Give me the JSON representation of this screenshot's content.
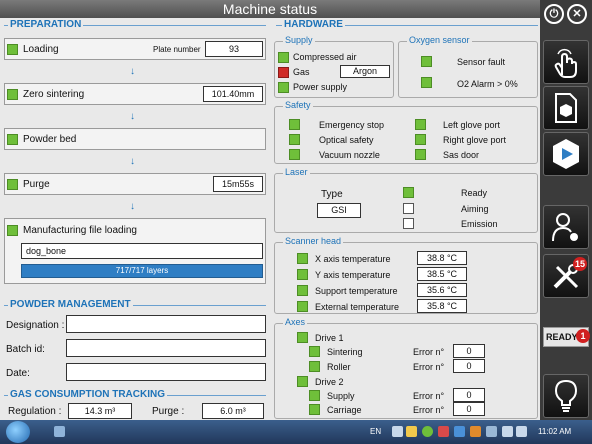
{
  "window": {
    "title": "Machine status"
  },
  "preparation": {
    "title": "PREPARATION",
    "loading": {
      "label": "Loading",
      "plate_label": "Plate number",
      "plate_value": "93"
    },
    "zero_sintering": {
      "label": "Zero sintering",
      "value": "101.40mm"
    },
    "powder_bed": {
      "label": "Powder bed"
    },
    "purge": {
      "label": "Purge",
      "value": "15m55s"
    },
    "manufacturing": {
      "label": "Manufacturing file loading",
      "file": "dog_bone",
      "progress_text": "717/717 layers",
      "progress_fraction": 1.0
    },
    "arrow": "↓"
  },
  "powder": {
    "title": "POWDER MANAGEMENT",
    "designation_label": "Designation :",
    "batch_label": "Batch id:",
    "date_label": "Date:",
    "designation_value": "",
    "batch_value": "",
    "date_value": ""
  },
  "gas": {
    "title": "GAS CONSUMPTION TRACKING",
    "regulation_label": "Regulation :",
    "regulation_value": "14.3 m³",
    "purge_label": "Purge :",
    "purge_value": "6.0 m³"
  },
  "hardware": {
    "title": "HARDWARE",
    "supply": {
      "title": "Supply",
      "compressed_air": "Compressed air",
      "gas": "Gas",
      "gas_value": "Argon",
      "power_supply": "Power supply"
    },
    "oxygen": {
      "title": "Oxygen sensor",
      "sensor_fault": "Sensor fault",
      "alarm": "O2 Alarm > 0%"
    },
    "safety": {
      "title": "Safety",
      "emergency_stop": "Emergency stop",
      "optical_safety": "Optical safety",
      "vacuum_nozzle": "Vacuum nozzle",
      "left_glove": "Left glove port",
      "right_glove": "Right glove port",
      "sas_door": "Sas door"
    },
    "laser": {
      "title": "Laser",
      "type_label": "Type",
      "type_value": "GSI",
      "ready": "Ready",
      "aiming": "Aiming",
      "emission": "Emission"
    },
    "scanner": {
      "title": "Scanner head",
      "x_label": "X axis temperature",
      "x_value": "38.8 °C",
      "y_label": "Y axis temperature",
      "y_value": "38.5 °C",
      "support_label": "Support temperature",
      "support_value": "35.6 °C",
      "external_label": "External temperature",
      "external_value": "35.8 °C"
    },
    "axes": {
      "title": "Axes",
      "drive1": "Drive 1",
      "sintering": "Sintering",
      "roller": "Roller",
      "drive2": "Drive 2",
      "supply": "Supply",
      "carriage": "Carriage",
      "error_label": "Error n°",
      "sintering_error": "0",
      "roller_error": "0",
      "supply_error": "0",
      "carriage_error": "0"
    }
  },
  "sidebar": {
    "alerts_badge": "15",
    "ready_label": "READY",
    "ready_badge": "1"
  },
  "taskbar": {
    "lang": "EN",
    "time": "11:02 AM"
  },
  "colors": {
    "ok": "#6fbf3a",
    "fault": "#cf2a27",
    "accent": "#1e73b8"
  },
  "icons": [
    "power-icon",
    "close-icon",
    "touch-hand-icon",
    "document-cube-icon",
    "cube-play-icon",
    "user-settings-icon",
    "tools-icon",
    "lightbulb-icon",
    "windows-start-icon"
  ]
}
